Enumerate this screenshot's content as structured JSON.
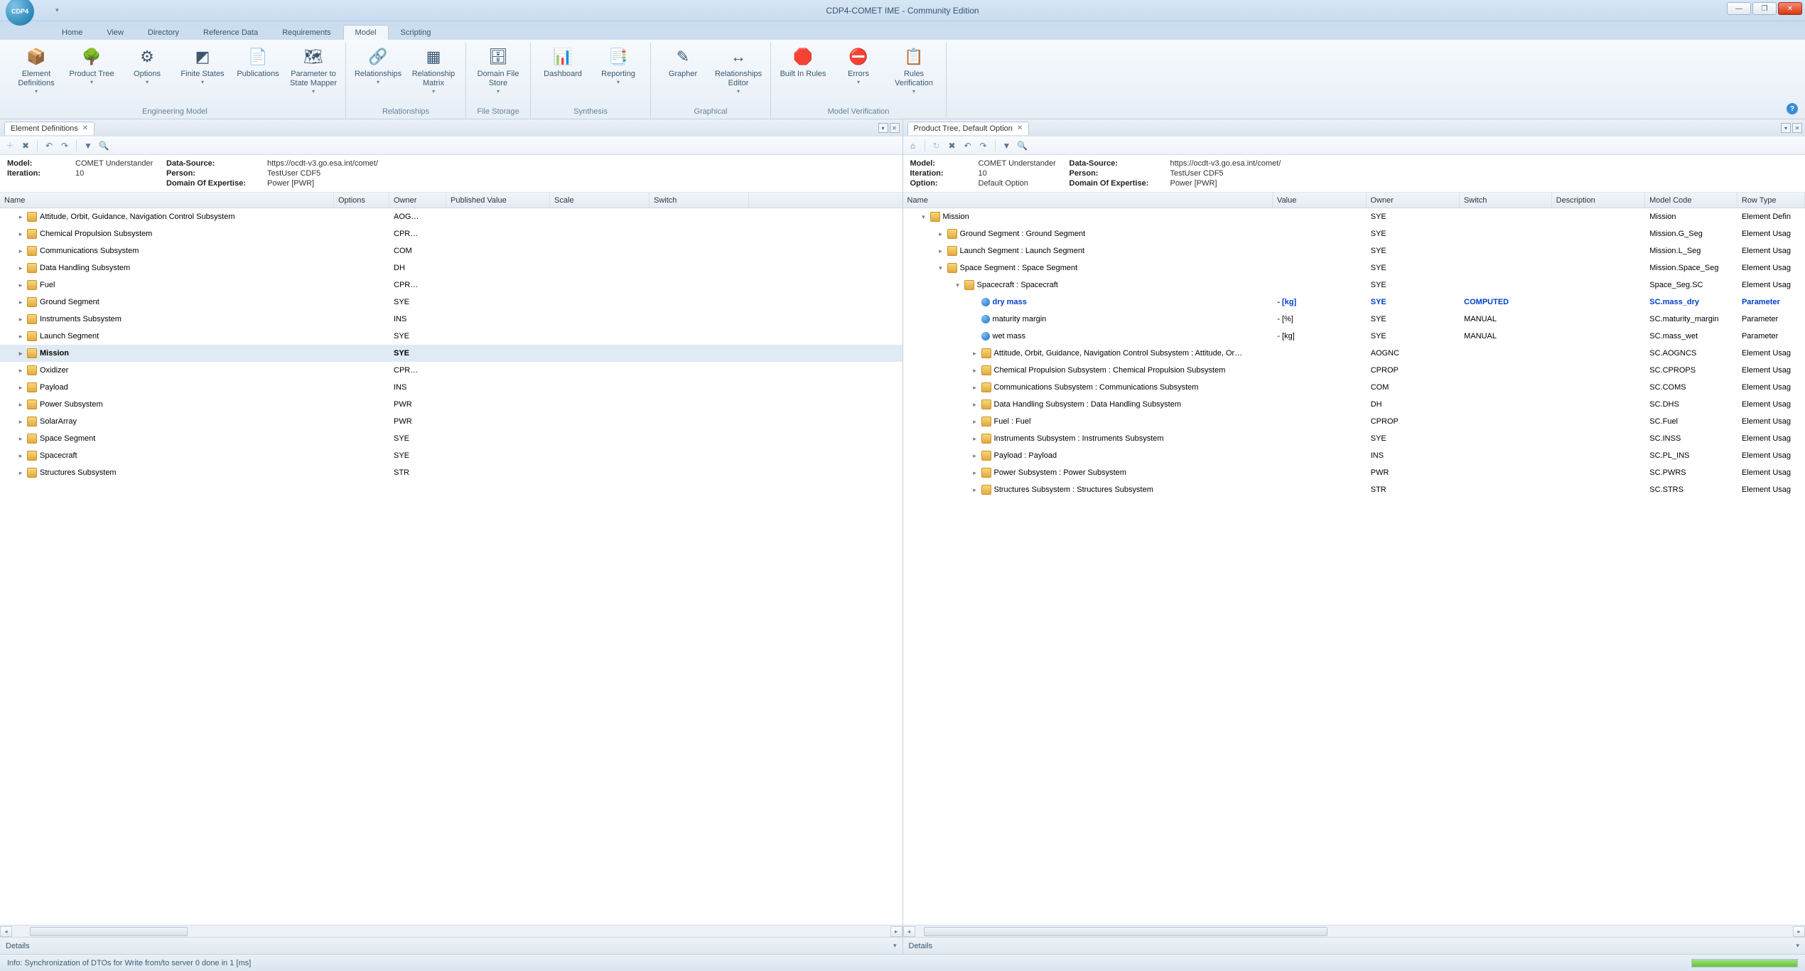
{
  "window": {
    "title": "CDP4-COMET IME - Community Edition",
    "orb": "CDP4"
  },
  "menu": {
    "items": [
      "Home",
      "View",
      "Directory",
      "Reference Data",
      "Requirements",
      "Model",
      "Scripting"
    ],
    "active": 5
  },
  "ribbon": {
    "groups": [
      {
        "label": "Engineering Model",
        "buttons": [
          {
            "label": "Element Definitions",
            "drop": true,
            "icon": "📦"
          },
          {
            "label": "Product Tree",
            "drop": true,
            "icon": "🌳"
          },
          {
            "label": "Options",
            "drop": true,
            "icon": "⚙"
          },
          {
            "label": "Finite States",
            "drop": true,
            "icon": "◩"
          },
          {
            "label": "Publications",
            "icon": "📄"
          },
          {
            "label": "Parameter to State Mapper",
            "drop": true,
            "icon": "🗺"
          }
        ]
      },
      {
        "label": "Relationships",
        "buttons": [
          {
            "label": "Relationships",
            "drop": true,
            "icon": "🔗"
          },
          {
            "label": "Relationship Matrix",
            "drop": true,
            "icon": "▦"
          }
        ]
      },
      {
        "label": "File Storage",
        "buttons": [
          {
            "label": "Domain File Store",
            "drop": true,
            "icon": "🗄"
          }
        ]
      },
      {
        "label": "Synthesis",
        "buttons": [
          {
            "label": "Dashboard",
            "icon": "📊"
          },
          {
            "label": "Reporting",
            "drop": true,
            "icon": "📑"
          }
        ]
      },
      {
        "label": "Graphical",
        "buttons": [
          {
            "label": "Grapher",
            "icon": "✎"
          },
          {
            "label": "Relationships Editor",
            "drop": true,
            "icon": "↔"
          }
        ]
      },
      {
        "label": "Model Verification",
        "buttons": [
          {
            "label": "Built In Rules",
            "icon": "🛑"
          },
          {
            "label": "Errors",
            "drop": true,
            "icon": "⛔"
          },
          {
            "label": "Rules Verification",
            "drop": true,
            "icon": "📋"
          }
        ]
      }
    ]
  },
  "left": {
    "tab": "Element Definitions",
    "meta": {
      "model_l": "Model:",
      "model_v": "COMET Understander",
      "ds_l": "Data-Source:",
      "ds_v": "https://ocdt-v3.go.esa.int/comet/",
      "iter_l": "Iteration:",
      "iter_v": "10",
      "person_l": "Person:",
      "person_v": "TestUser CDF5",
      "doe_l": "Domain Of Expertise:",
      "doe_v": "Power [PWR]"
    },
    "cols": [
      "Name",
      "Options",
      "Owner",
      "Published Value",
      "Scale",
      "Switch"
    ],
    "rows": [
      {
        "name": "Attitude, Orbit, Guidance, Navigation Control Subsystem",
        "owner": "AOG…"
      },
      {
        "name": "Chemical Propulsion Subsystem",
        "owner": "CPR…"
      },
      {
        "name": "Communications Subsystem",
        "owner": "COM"
      },
      {
        "name": "Data Handling Subsystem",
        "owner": "DH"
      },
      {
        "name": "Fuel",
        "owner": "CPR…"
      },
      {
        "name": "Ground Segment",
        "owner": "SYE"
      },
      {
        "name": "Instruments Subsystem",
        "owner": "INS"
      },
      {
        "name": "Launch Segment",
        "owner": "SYE"
      },
      {
        "name": "Mission",
        "owner": "SYE",
        "selected": true,
        "bold": true
      },
      {
        "name": "Oxidizer",
        "owner": "CPR…"
      },
      {
        "name": "Payload",
        "owner": "INS"
      },
      {
        "name": "Power Subsystem",
        "owner": "PWR"
      },
      {
        "name": "SolarArray",
        "owner": "PWR"
      },
      {
        "name": "Space Segment",
        "owner": "SYE"
      },
      {
        "name": "Spacecraft",
        "owner": "SYE"
      },
      {
        "name": "Structures Subsystem",
        "owner": "STR"
      }
    ],
    "details": "Details"
  },
  "right": {
    "tab": "Product Tree, Default Option",
    "meta": {
      "model_l": "Model:",
      "model_v": "COMET Understander",
      "ds_l": "Data-Source:",
      "ds_v": "https://ocdt-v3.go.esa.int/comet/",
      "iter_l": "Iteration:",
      "iter_v": "10",
      "person_l": "Person:",
      "person_v": "TestUser CDF5",
      "opt_l": "Option:",
      "opt_v": "Default Option",
      "doe_l": "Domain Of Expertise:",
      "doe_v": "Power [PWR]"
    },
    "cols": [
      "Name",
      "Value",
      "Owner",
      "Switch",
      "Description",
      "Model Code",
      "Row Type"
    ],
    "rows": [
      {
        "indent": 0,
        "exp": "▾",
        "icon": "f",
        "name": "Mission",
        "owner": "SYE",
        "mcode": "Mission",
        "rtype": "Element Defin"
      },
      {
        "indent": 1,
        "exp": "▸",
        "icon": "f",
        "name": "Ground Segment : Ground Segment",
        "owner": "SYE",
        "mcode": "Mission.G_Seg",
        "rtype": "Element Usag"
      },
      {
        "indent": 1,
        "exp": "▸",
        "icon": "f",
        "name": "Launch Segment : Launch Segment",
        "owner": "SYE",
        "mcode": "Mission.L_Seg",
        "rtype": "Element Usag"
      },
      {
        "indent": 1,
        "exp": "▾",
        "icon": "f",
        "name": "Space Segment : Space Segment",
        "owner": "SYE",
        "mcode": "Mission.Space_Seg",
        "rtype": "Element Usag"
      },
      {
        "indent": 2,
        "exp": "▾",
        "icon": "f",
        "name": "Spacecraft : Spacecraft",
        "owner": "SYE",
        "mcode": "Space_Seg.SC",
        "rtype": "Element Usag"
      },
      {
        "indent": 3,
        "exp": "",
        "icon": "p",
        "name": "dry mass",
        "value": "-  [kg]",
        "owner": "SYE",
        "switch": "COMPUTED",
        "mcode": "SC.mass_dry",
        "rtype": "Parameter",
        "blue": true
      },
      {
        "indent": 3,
        "exp": "",
        "icon": "p",
        "name": "maturity margin",
        "value": "-  [%]",
        "owner": "SYE",
        "switch": "MANUAL",
        "mcode": "SC.maturity_margin",
        "rtype": "Parameter"
      },
      {
        "indent": 3,
        "exp": "",
        "icon": "p",
        "name": "wet mass",
        "value": "-  [kg]",
        "owner": "SYE",
        "switch": "MANUAL",
        "mcode": "SC.mass_wet",
        "rtype": "Parameter"
      },
      {
        "indent": 3,
        "exp": "▸",
        "icon": "f",
        "name": "Attitude, Orbit, Guidance, Navigation Control Subsystem : Attitude, Or…",
        "owner": "AOGNC",
        "mcode": "SC.AOGNCS",
        "rtype": "Element Usag"
      },
      {
        "indent": 3,
        "exp": "▸",
        "icon": "f",
        "name": "Chemical Propulsion Subsystem : Chemical Propulsion Subsystem",
        "owner": "CPROP",
        "mcode": "SC.CPROPS",
        "rtype": "Element Usag"
      },
      {
        "indent": 3,
        "exp": "▸",
        "icon": "f",
        "name": "Communications Subsystem : Communications Subsystem",
        "owner": "COM",
        "mcode": "SC.COMS",
        "rtype": "Element Usag"
      },
      {
        "indent": 3,
        "exp": "▸",
        "icon": "f",
        "name": "Data Handling Subsystem : Data Handling Subsystem",
        "owner": "DH",
        "mcode": "SC.DHS",
        "rtype": "Element Usag"
      },
      {
        "indent": 3,
        "exp": "▸",
        "icon": "f",
        "name": "Fuel : Fuel",
        "owner": "CPROP",
        "mcode": "SC.Fuel",
        "rtype": "Element Usag"
      },
      {
        "indent": 3,
        "exp": "▸",
        "icon": "f",
        "name": "Instruments Subsystem : Instruments Subsystem",
        "owner": "SYE",
        "mcode": "SC.INSS",
        "rtype": "Element Usag"
      },
      {
        "indent": 3,
        "exp": "▸",
        "icon": "f",
        "name": "Payload : Payload",
        "owner": "INS",
        "mcode": "SC.PL_INS",
        "rtype": "Element Usag"
      },
      {
        "indent": 3,
        "exp": "▸",
        "icon": "f",
        "name": "Power Subsystem : Power Subsystem",
        "owner": "PWR",
        "mcode": "SC.PWRS",
        "rtype": "Element Usag"
      },
      {
        "indent": 3,
        "exp": "▸",
        "icon": "f",
        "name": "Structures Subsystem : Structures Subsystem",
        "owner": "STR",
        "mcode": "SC.STRS",
        "rtype": "Element Usag"
      }
    ],
    "details": "Details"
  },
  "status": {
    "text": "Info: Synchronization of DTOs for Write from/to server 0 done in 1 [ms]"
  }
}
